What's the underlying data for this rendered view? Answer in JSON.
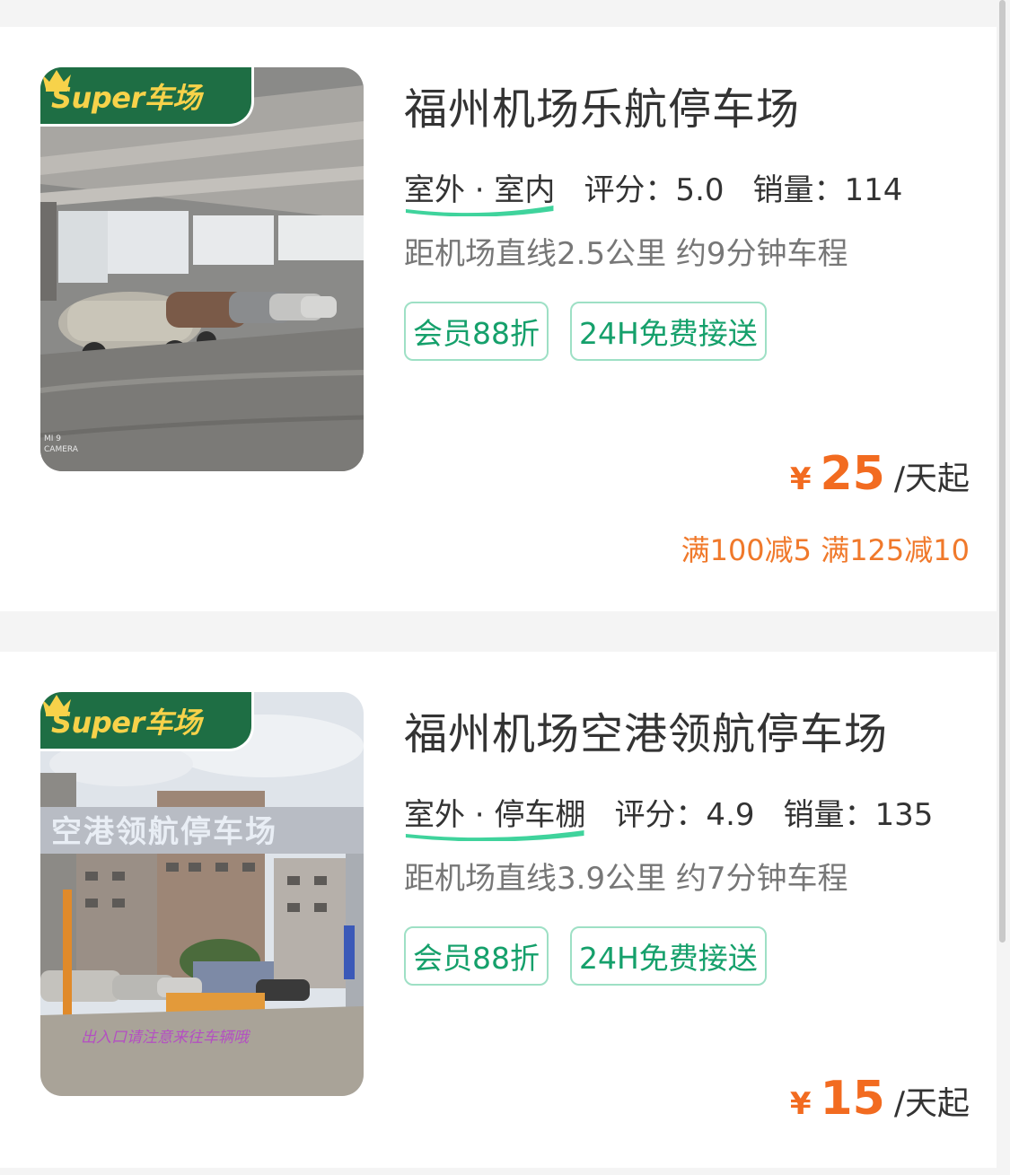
{
  "colors": {
    "accent_green": "#15a06b",
    "price_orange": "#f26b20",
    "badge_green": "#1e6e44",
    "badge_text": "#f7d24a"
  },
  "badge_label": "Super车场",
  "price_yen": "¥",
  "price_unit": "/天起",
  "listings": [
    {
      "name": "福州机场乐航停车场",
      "types": "室外 · 室内",
      "rating": "评分：5.0",
      "sales": "销量：114",
      "distance": "距机场直线2.5公里 约9分钟车程",
      "tags": [
        "会员88折",
        "24H免费接送"
      ],
      "price": "25",
      "promo": "满100减5 满125减10",
      "photo": "indoor-garage-photo",
      "photo_watermark": [
        "MI 9",
        "CAMERA"
      ]
    },
    {
      "name": "福州机场空港领航停车场",
      "types": "室外 · 停车棚",
      "rating": "评分：4.9",
      "sales": "销量：135",
      "distance": "距机场直线3.9公里 约7分钟车程",
      "tags": [
        "会员88折",
        "24H免费接送"
      ],
      "price": "15",
      "photo": "outdoor-gate-photo",
      "photo_sign": "空港领航停车场",
      "photo_ground_text": "出入口请注意来往车辆哦"
    }
  ]
}
